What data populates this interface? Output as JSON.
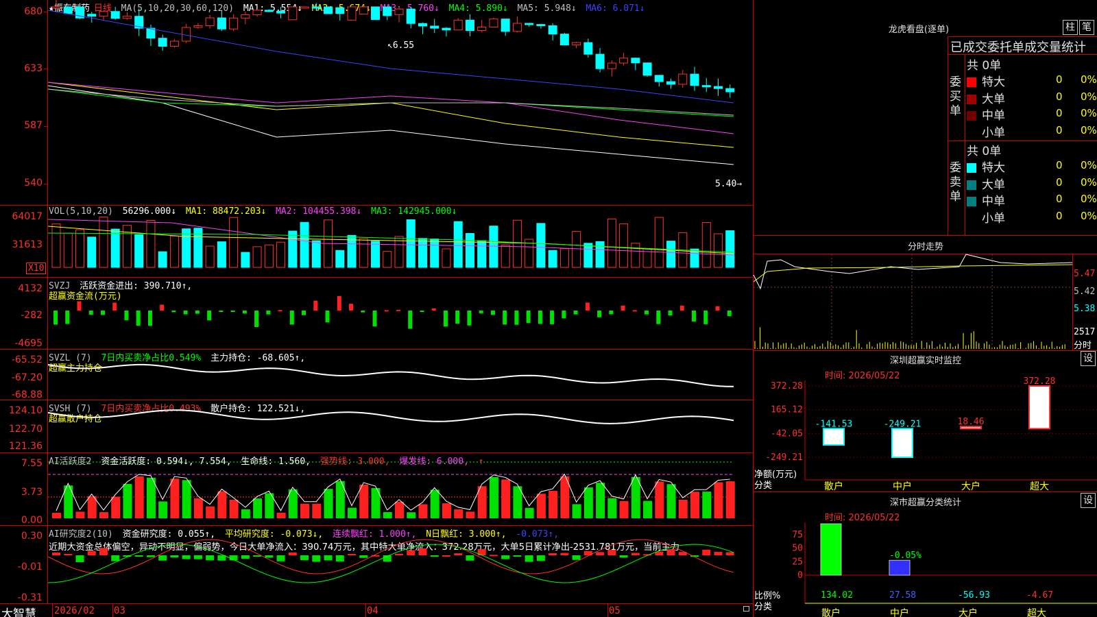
{
  "kline": {
    "title": "★振东制药",
    "period": "日线",
    "ma_header": "MA(5,10,20,30,60,120)",
    "ma1": "MA1: 5.554↓",
    "ma2": "MA2: 5.674↓",
    "ma3": "MA3: 5.760↓",
    "ma4": "MA4: 5.890↓",
    "ma5": "MA5: 5.948↓",
    "ma6": "MA6: 6.071↓",
    "y_labels": [
      "680",
      "633",
      "587",
      "540"
    ],
    "high_label": "6.55",
    "low_label": "5.40"
  },
  "vol": {
    "header": "VOL(5,10,20)",
    "value": "56296.000↓",
    "ma1": "MA1: 88472.203↓",
    "ma2": "MA2: 104455.398↓",
    "ma3": "MA3: 142945.000↓",
    "y_labels": [
      "64017",
      "31613"
    ],
    "unit": "X10"
  },
  "svzj": {
    "header": "SVZJ",
    "label": "活跃资金进出: 390.710↑,",
    "sub": "超赢资金流(万元)",
    "y_labels": [
      "4132",
      "-282",
      "-4695"
    ]
  },
  "svzl": {
    "header": "SVZL (7)",
    "ratio": "7日内买卖净占比0.549%",
    "label": "主力持仓: -68.605↑,",
    "sub": "超赢主力持仓",
    "y_labels": [
      "-65.52",
      "-67.20",
      "-68.88"
    ]
  },
  "svsh": {
    "header": "SVSH (7)",
    "ratio": "7日内买卖净占比0.493%",
    "label": "散户持仓: 122.521↓,",
    "sub": "超赢散户持仓",
    "y_labels": [
      "124.10",
      "122.70",
      "121.36"
    ]
  },
  "ai_active": {
    "header": "AI活跃度2",
    "label": "资金活跃度: 0.594↓, 7.554,",
    "life": "生命线: 1.560,",
    "strong": "强势线: 3.000,",
    "burst": "爆发线: 6.000,",
    "arrow": "↑",
    "y_labels": [
      "7.55",
      "3.73",
      "0.00"
    ]
  },
  "ai_research": {
    "header": "AI研究度2(10)",
    "label": "资金研究度: 0.055↑,",
    "avg": "平均研究度: -0.073↓,",
    "cont": "连续飘红: 1.000↑,",
    "nday": "N日飘红: 3.000↑,",
    "last": "-0.073↑,",
    "comment": "近期大资金总体偏空，异动不明显，偏弱势，今日大单净流入：390.74万元，其中特大单净流入：372.28万元，大单5日累计净出-2531.781万元，当前主力",
    "y_labels": [
      "0.30",
      "-0.01",
      "-0.31"
    ]
  },
  "footer": {
    "brand": "大智慧",
    "dates": [
      "2026/02",
      "03",
      "04",
      "05"
    ]
  },
  "right": {
    "lhb_title": "龙虎看盘(逐单)",
    "btn_zhu": "柱",
    "btn_bi": "笔",
    "stats_title": "已成交委托单成交量统计",
    "buy_label": "委买单",
    "sell_label": "委卖单",
    "buy_total": "共 0单",
    "sell_total": "共 0单",
    "buy_rows": [
      {
        "name": "特大",
        "count": "0",
        "pct": "0%",
        "color": "#ff0000"
      },
      {
        "name": "大单",
        "count": "0",
        "pct": "0%",
        "color": "#a00000"
      },
      {
        "name": "中单",
        "count": "0",
        "pct": "0%",
        "color": "#700000"
      },
      {
        "name": "小单",
        "count": "0",
        "pct": "0%",
        "color": ""
      }
    ],
    "sell_rows": [
      {
        "name": "特大",
        "count": "0",
        "pct": "0%",
        "color": "#00ffff"
      },
      {
        "name": "大单",
        "count": "0",
        "pct": "0%",
        "color": "#008080"
      },
      {
        "name": "中单",
        "count": "0",
        "pct": "0%",
        "color": "#008080"
      },
      {
        "name": "小单",
        "count": "0",
        "pct": "0%",
        "color": ""
      }
    ],
    "intraday_title": "分时走势",
    "intraday_y": [
      "5.47",
      "5.42",
      "5.38"
    ],
    "intraday_vol": "2517",
    "intraday_unit": "分时",
    "monitor_title": "深圳超赢实时监控",
    "monitor_btn": "设",
    "monitor_time": "时间: 2026/05/22",
    "monitor_y": [
      "372.28",
      "165.12",
      "-42.05",
      "-249.21"
    ],
    "monitor_ylabel": "净额(万元)",
    "monitor_xlabel": "分类",
    "classify_title": "深市超赢分类统计",
    "classify_btn": "设",
    "classify_time": "时间: 2026/05/22",
    "classify_y": [
      "75",
      "50",
      "25",
      "0"
    ],
    "classify_ylabel": "比例%",
    "classify_xlabel": "分类"
  },
  "chart_data": [
    {
      "type": "bar",
      "title": "深圳超赢实时监控",
      "categories": [
        "散户",
        "中户",
        "大户",
        "超大"
      ],
      "values": [
        -141.53,
        -249.21,
        18.46,
        372.28
      ],
      "ylabel": "净额(万元)",
      "xlabel": "分类",
      "ylim": [
        -249.21,
        372.28
      ]
    },
    {
      "type": "bar",
      "title": "深市超赢分类统计",
      "categories": [
        "散户",
        "中户",
        "大户",
        "超大"
      ],
      "values": [
        134.02,
        27.58,
        -56.93,
        -4.67
      ],
      "annotation": "-0.05%",
      "ylabel": "比例%",
      "xlabel": "分类",
      "ylim": [
        0,
        75
      ]
    }
  ]
}
